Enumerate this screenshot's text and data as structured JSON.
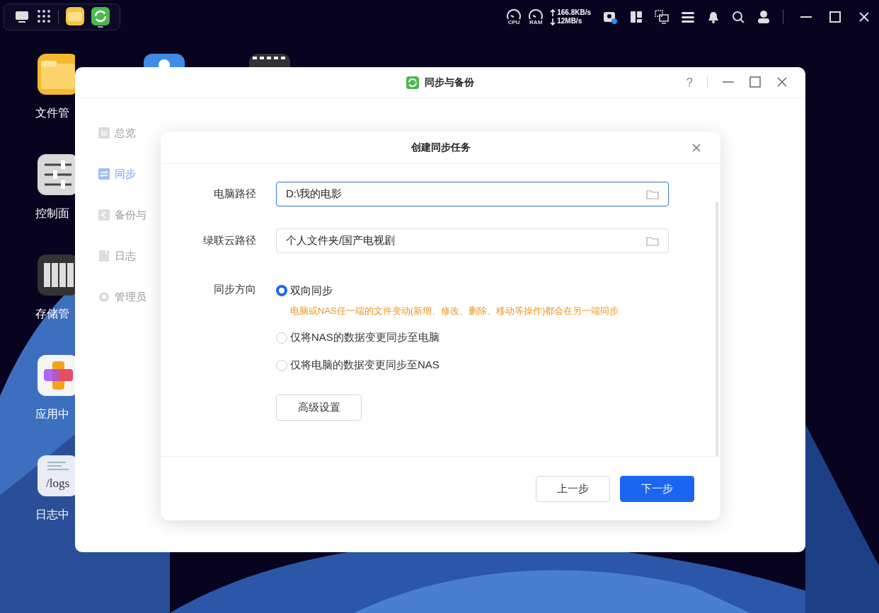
{
  "top_bar": {
    "dock": [
      {
        "kind": "desktop",
        "running": false
      },
      {
        "kind": "grid",
        "running": false
      },
      {
        "kind": "files",
        "running": false
      },
      {
        "kind": "sync",
        "running": true
      }
    ],
    "system": {
      "cpu_label": "CPU",
      "ram_label": "RAM",
      "upload": "166.8KB/s",
      "download": "12MB/s"
    }
  },
  "desktop_icons": [
    {
      "kind": "folder",
      "label": "文件管"
    },
    {
      "kind": "sliders",
      "label": "控制面"
    },
    {
      "kind": "storage",
      "label": "存储管"
    },
    {
      "kind": "apps",
      "label": "应用中"
    },
    {
      "kind": "logs",
      "label": "日志中",
      "icon_text": "/logs"
    }
  ],
  "desktop_icons_column_2": [
    {
      "kind": "cloud"
    },
    {
      "kind": "video"
    }
  ],
  "window": {
    "title": "同步与备份",
    "help_label": "?",
    "sidebar": [
      {
        "kind": "overview",
        "label": "总览",
        "selected": false
      },
      {
        "kind": "sync",
        "label": "同步",
        "selected": true
      },
      {
        "kind": "backup",
        "label": "备份与",
        "selected": false
      },
      {
        "kind": "log",
        "label": "日志",
        "selected": false
      },
      {
        "kind": "admin",
        "label": "管理员",
        "selected": false
      }
    ]
  },
  "dialog": {
    "title": "创建同步任务",
    "fields": [
      {
        "label": "电脑路径",
        "value": "D:\\我的电影",
        "focused": true
      },
      {
        "label": "绿联云路径",
        "value": "个人文件夹/国产电视剧",
        "focused": false
      }
    ],
    "direction": {
      "label": "同步方向",
      "options": [
        {
          "label": "双向同步",
          "selected": true,
          "note": "电脑或NAS任一端的文件变动(新增、修改、删除、移动等操作)都会在另一端同步"
        },
        {
          "label": "仅将NAS的数据变更同步至电脑",
          "selected": false
        },
        {
          "label": "仅将电脑的数据变更同步至NAS",
          "selected": false
        }
      ]
    },
    "advanced_button": "高级设置",
    "buttons": [
      {
        "kind": "secondary",
        "label": "上一步"
      },
      {
        "kind": "primary",
        "label": "下一步"
      }
    ]
  }
}
